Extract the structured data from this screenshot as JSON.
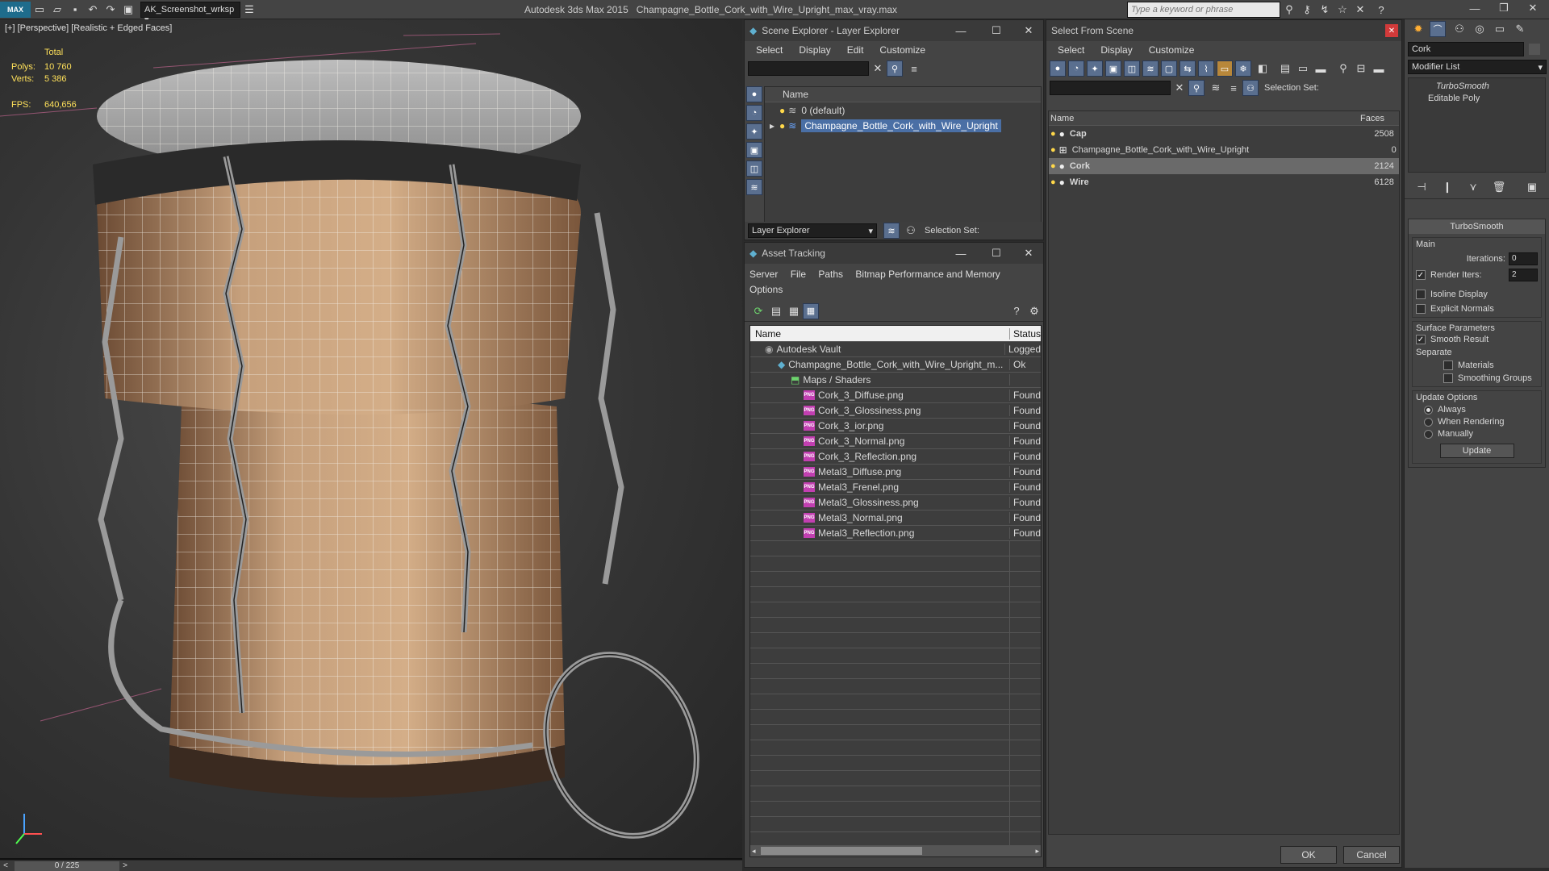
{
  "window": {
    "app_title": "Autodesk 3ds Max  2015",
    "file_title": "Champagne_Bottle_Cork_with_Wire_Upright_max_vray.max",
    "workspace": "AK_Screenshot_wrksp",
    "search_placeholder": "Type a keyword or phrase",
    "max_button": "MAX"
  },
  "viewport": {
    "label": "[+] [Perspective] [Realistic + Edged Faces]",
    "stats": {
      "total_label": "Total",
      "polys_label": "Polys:",
      "polys_value": "10 760",
      "verts_label": "Verts:",
      "verts_value": "5 386",
      "fps_label": "FPS:",
      "fps_value": "640,656"
    },
    "timeline": {
      "frame": "0 / 225",
      "prev": "<",
      "next": ">"
    }
  },
  "scene_explorer": {
    "title": "Scene Explorer - Layer Explorer",
    "menu": [
      "Select",
      "Display",
      "Edit",
      "Customize"
    ],
    "column": "Name",
    "layers": [
      {
        "name": "0 (default)",
        "selected": false
      },
      {
        "name": "Champagne_Bottle_Cork_with_Wire_Upright",
        "selected": true
      }
    ],
    "footer_dropdown": "Layer Explorer",
    "selection_set_label": "Selection Set:"
  },
  "asset_tracking": {
    "title": "Asset Tracking",
    "menu": [
      "Server",
      "File",
      "Paths",
      "Bitmap Performance and Memory"
    ],
    "menu2": [
      "Options"
    ],
    "columns": {
      "name": "Name",
      "status": "Status"
    },
    "rows": [
      {
        "name": "Autodesk Vault",
        "status": "Logged",
        "level": 0,
        "icon": "vault"
      },
      {
        "name": "Champagne_Bottle_Cork_with_Wire_Upright_m...",
        "status": "Ok",
        "level": 1,
        "icon": "max"
      },
      {
        "name": "Maps / Shaders",
        "status": "",
        "level": 2,
        "icon": "maps"
      },
      {
        "name": "Cork_3_Diffuse.png",
        "status": "Found",
        "level": 3,
        "icon": "png"
      },
      {
        "name": "Cork_3_Glossiness.png",
        "status": "Found",
        "level": 3,
        "icon": "png"
      },
      {
        "name": "Cork_3_ior.png",
        "status": "Found",
        "level": 3,
        "icon": "png"
      },
      {
        "name": "Cork_3_Normal.png",
        "status": "Found",
        "level": 3,
        "icon": "png"
      },
      {
        "name": "Cork_3_Reflection.png",
        "status": "Found",
        "level": 3,
        "icon": "png"
      },
      {
        "name": "Metal3_Diffuse.png",
        "status": "Found",
        "level": 3,
        "icon": "png"
      },
      {
        "name": "Metal3_Frenel.png",
        "status": "Found",
        "level": 3,
        "icon": "png"
      },
      {
        "name": "Metal3_Glossiness.png",
        "status": "Found",
        "level": 3,
        "icon": "png"
      },
      {
        "name": "Metal3_Normal.png",
        "status": "Found",
        "level": 3,
        "icon": "png"
      },
      {
        "name": "Metal3_Reflection.png",
        "status": "Found",
        "level": 3,
        "icon": "png"
      }
    ]
  },
  "select_from_scene": {
    "title": "Select From Scene",
    "menu": [
      "Select",
      "Display",
      "Customize"
    ],
    "selection_set_label": "Selection Set:",
    "columns": {
      "name": "Name",
      "faces": "Faces"
    },
    "rows": [
      {
        "name": "Cap",
        "faces": "2508",
        "bold": true,
        "selected": false
      },
      {
        "name": "Champagne_Bottle_Cork_with_Wire_Upright",
        "faces": "0",
        "bold": false,
        "selected": false
      },
      {
        "name": "Cork",
        "faces": "2124",
        "bold": true,
        "selected": true
      },
      {
        "name": "Wire",
        "faces": "6128",
        "bold": true,
        "selected": false
      }
    ],
    "ok": "OK",
    "cancel": "Cancel"
  },
  "command_panel": {
    "object_name": "Cork",
    "modifier_list": "Modifier List",
    "stack": [
      "TurboSmooth",
      "Editable Poly"
    ],
    "rollout_title": "TurboSmooth",
    "main_label": "Main",
    "iterations_label": "Iterations:",
    "iterations_value": "0",
    "render_iters_label": "Render Iters:",
    "render_iters_value": "2",
    "isoline": "Isoline Display",
    "explicit_normals": "Explicit Normals",
    "surface_params": "Surface Parameters",
    "smooth_result": "Smooth Result",
    "separate": "Separate",
    "materials": "Materials",
    "smoothing_groups": "Smoothing Groups",
    "update_options": "Update Options",
    "always": "Always",
    "when_rendering": "When Rendering",
    "manually": "Manually",
    "update_button": "Update"
  }
}
